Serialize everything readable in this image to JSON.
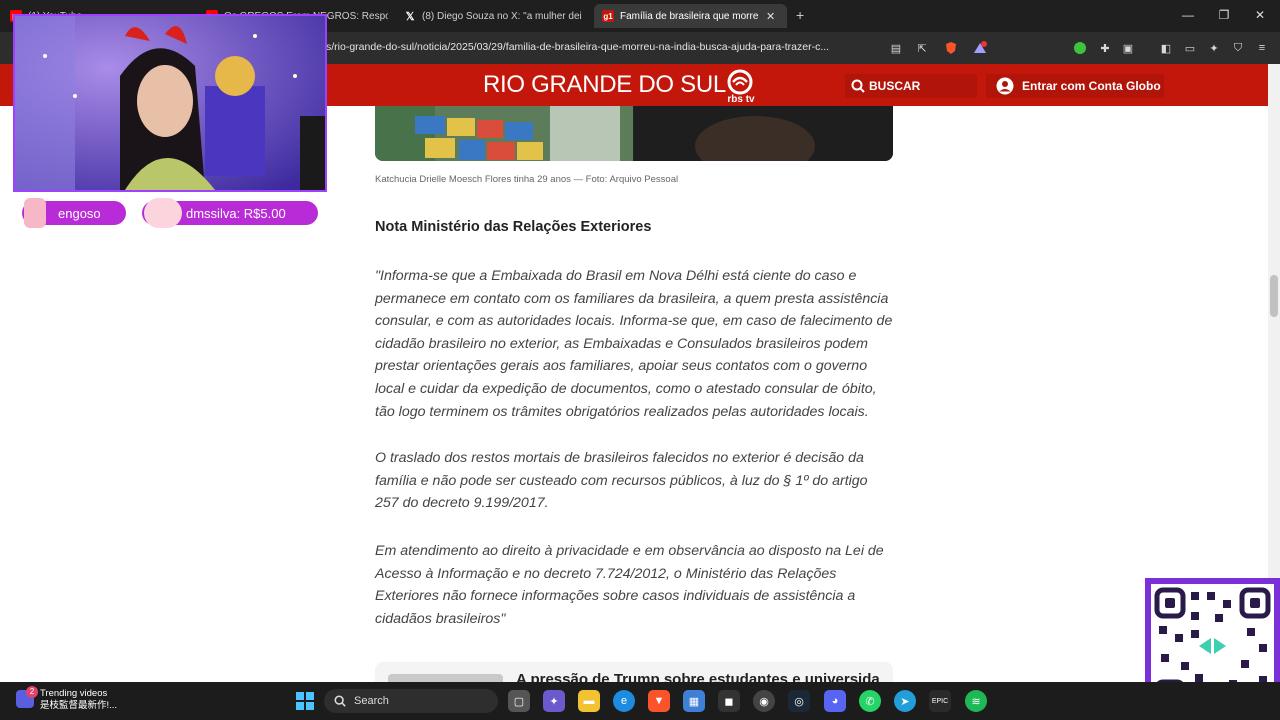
{
  "browser": {
    "tabs": [
      {
        "title": "(1) YouTube",
        "favicon": "youtube-icon"
      },
      {
        "title": "Os GREGOS Eram NEGROS: Respond",
        "favicon": "youtube-icon"
      },
      {
        "title": "(8) Diego Souza no X: \"a mulher deix",
        "favicon": "x-icon"
      },
      {
        "title": "Família de brasileira que morreu",
        "favicon": "g1-icon",
        "active": true
      }
    ],
    "new_tab": "+",
    "url": "s/rio-grande-do-sul/noticia/2025/03/29/familia-de-brasileira-que-morreu-na-india-busca-ajuda-para-trazer-c..."
  },
  "site": {
    "section_title": "RIO GRANDE DO SUL",
    "logo_text": "rbs tv",
    "search_label": "BUSCAR",
    "login_label": "Entrar com Conta Globo",
    "brand_color": "#c4170c"
  },
  "article": {
    "caption": "Katchucia Drielle Moesch Flores tinha 29 anos — Foto: Arquivo Pessoal",
    "subheading": "Nota Ministério das Relações Exteriores",
    "paragraphs": [
      "\"Informa-se que a Embaixada do Brasil em Nova Délhi está ciente do caso e permanece em contato com os familiares da brasileira, a quem presta assistência consular, e com as autoridades locais. Informa-se que, em caso de falecimento de cidadão brasileiro no exterior, as Embaixadas e Consulados brasileiros podem prestar orientações gerais aos familiares, apoiar seus contatos com o governo local e cuidar da expedição de documentos, como o atestado consular de óbito, tão logo terminem os trâmites obrigatórios realizados pelas autoridades locais.",
      "O traslado dos restos mortais de brasileiros falecidos no exterior é decisão da família e não pode ser custeado com recursos públicos, à luz do § 1º do artigo 257 do decreto 9.199/2017.",
      "Em atendimento ao direito à privacidade e em observância ao disposto na Lei de Acesso à Informação e no decreto 7.724/2012, o Ministério das Relações Exteriores não fornece informações sobre casos individuais de assistência a cidadãos brasileiros\""
    ],
    "related_title": "A pressão de Trump sobre estudantes e universida"
  },
  "overlay": {
    "donors": [
      {
        "text": "engoso"
      },
      {
        "text": "dmssilva: R$5.00"
      }
    ]
  },
  "taskbar": {
    "news_title": "Trending videos",
    "news_subtitle": "是枝監督最新作!...",
    "news_badge": "2",
    "search_label": "Search"
  }
}
